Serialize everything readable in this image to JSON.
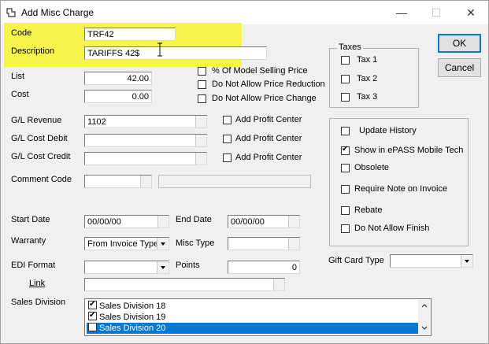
{
  "window": {
    "title": "Add Misc Charge",
    "minimize": "—",
    "maximize": "☐",
    "close": "✕"
  },
  "fields": {
    "code_label": "Code",
    "code_value": "TRF42",
    "description_label": "Description",
    "description_value": "TARIFFS 42$",
    "list_label": "List",
    "list_value": "42.00",
    "cost_label": "Cost",
    "cost_value": "0.00",
    "gl_revenue_label": "G/L Revenue",
    "gl_revenue_value": "1102",
    "gl_cost_debit_label": "G/L Cost Debit",
    "gl_cost_debit_value": "",
    "gl_cost_credit_label": "G/L Cost Credit",
    "gl_cost_credit_value": "",
    "comment_code_label": "Comment Code",
    "start_date_label": "Start Date",
    "start_date_value": "00/00/00",
    "end_date_label": "End Date",
    "end_date_value": "00/00/00",
    "warranty_label": "Warranty",
    "warranty_value": "From Invoice Type",
    "misc_type_label": "Misc Type",
    "misc_type_value": "",
    "edi_format_label": "EDI Format",
    "edi_format_value": "",
    "points_label": "Points",
    "points_value": "0",
    "link_label": "Link",
    "link_value": "",
    "sales_division_label": "Sales Division",
    "gift_card_type_label": "Gift Card Type",
    "gift_card_type_value": ""
  },
  "price_options": [
    {
      "label": "% Of Model Selling Price",
      "checked": false
    },
    {
      "label": "Do Not Allow Price Reduction",
      "checked": false
    },
    {
      "label": "Do Not Allow Price Change",
      "checked": false
    }
  ],
  "profit_center": {
    "label": "Add Profit Center"
  },
  "taxes": {
    "title": "Taxes",
    "items": [
      "Tax 1",
      "Tax 2",
      "Tax 3"
    ]
  },
  "options": [
    {
      "label": "Update History",
      "checked": false
    },
    {
      "label": "Show in ePASS Mobile Tech",
      "checked": true
    },
    {
      "label": "Obsolete",
      "checked": false
    },
    {
      "label": "Require Note on Invoice",
      "checked": false
    },
    {
      "label": "Rebate",
      "checked": false
    },
    {
      "label": "Do Not Allow Finish",
      "checked": false
    }
  ],
  "buttons": {
    "ok": "OK",
    "cancel": "Cancel"
  },
  "sales_divisions": [
    {
      "label": "Sales Division 18",
      "checked": true,
      "selected": false
    },
    {
      "label": "Sales Division 19",
      "checked": true,
      "selected": false
    },
    {
      "label": "Sales Division 20",
      "checked": true,
      "selected": true
    }
  ],
  "colors": {
    "highlight": "#f8f531",
    "selection": "#0078d7"
  }
}
